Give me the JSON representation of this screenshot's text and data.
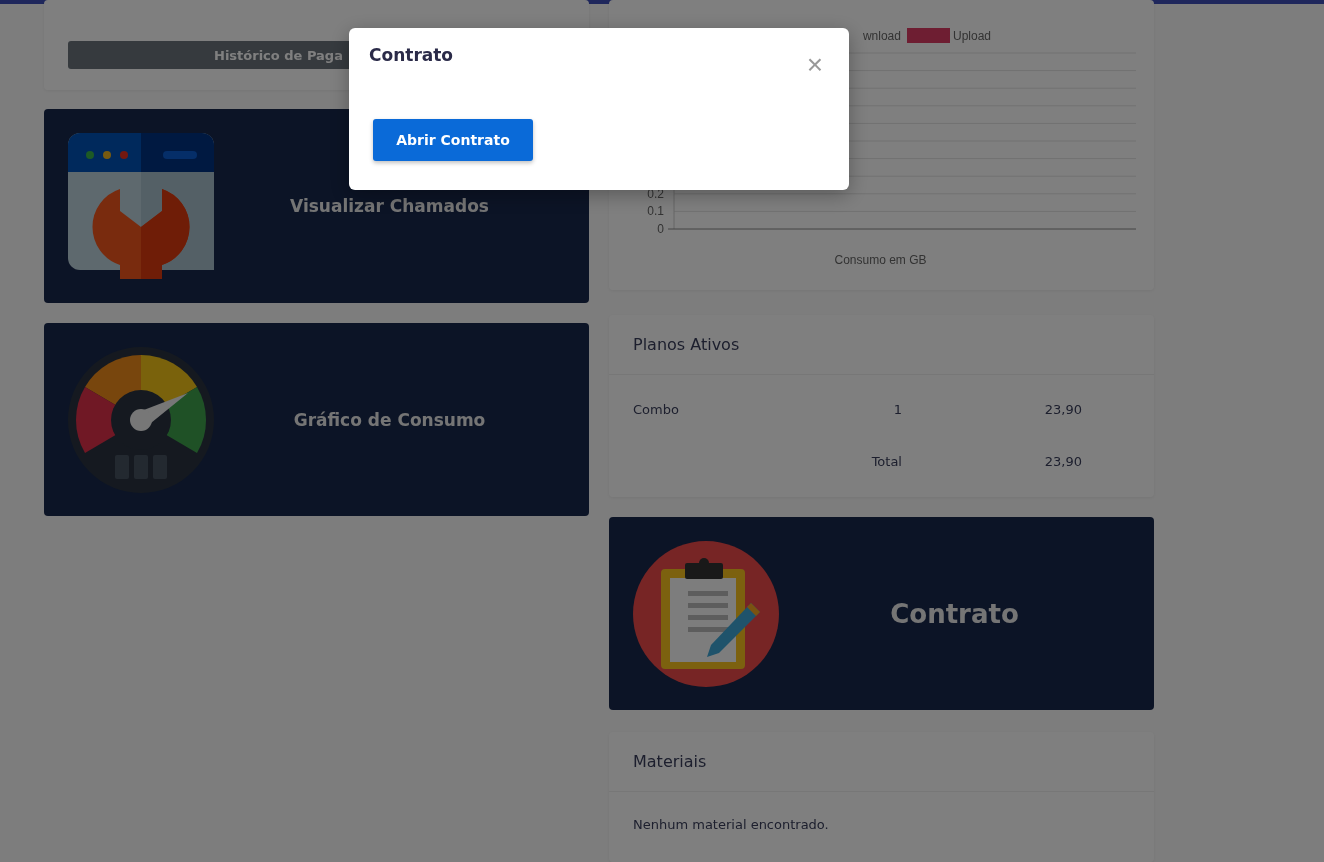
{
  "payment_history_button": "Histórico de Paga",
  "shortcut_cards": [
    {
      "kind": "tickets",
      "label": "Visualizar Chamados"
    },
    {
      "kind": "gauge",
      "label": "Gráfico de Consumo"
    }
  ],
  "consumption_chart": {
    "chart_data": {
      "type": "bar",
      "xlabel": "Consumo em GB",
      "ylim": [
        0,
        1
      ],
      "yticks": [
        0,
        0.1,
        0.2
      ],
      "series": [
        {
          "name": "wnload"
        },
        {
          "name": "Upload",
          "color": "#dc3c64"
        }
      ]
    }
  },
  "active_plans": {
    "title": "Planos Ativos",
    "rows": [
      {
        "kind": "item",
        "name": "Combo",
        "quantity": "1",
        "price": "23,90"
      },
      {
        "kind": "total",
        "quantity": "Total",
        "price": "23,90"
      }
    ]
  },
  "contract_card": {
    "label": "Contrato"
  },
  "materials": {
    "title": "Materiais",
    "empty_text": "Nenhum material encontrado."
  },
  "modal": {
    "title": "Contrato",
    "close": "×",
    "button": "Abrir Contrato"
  }
}
